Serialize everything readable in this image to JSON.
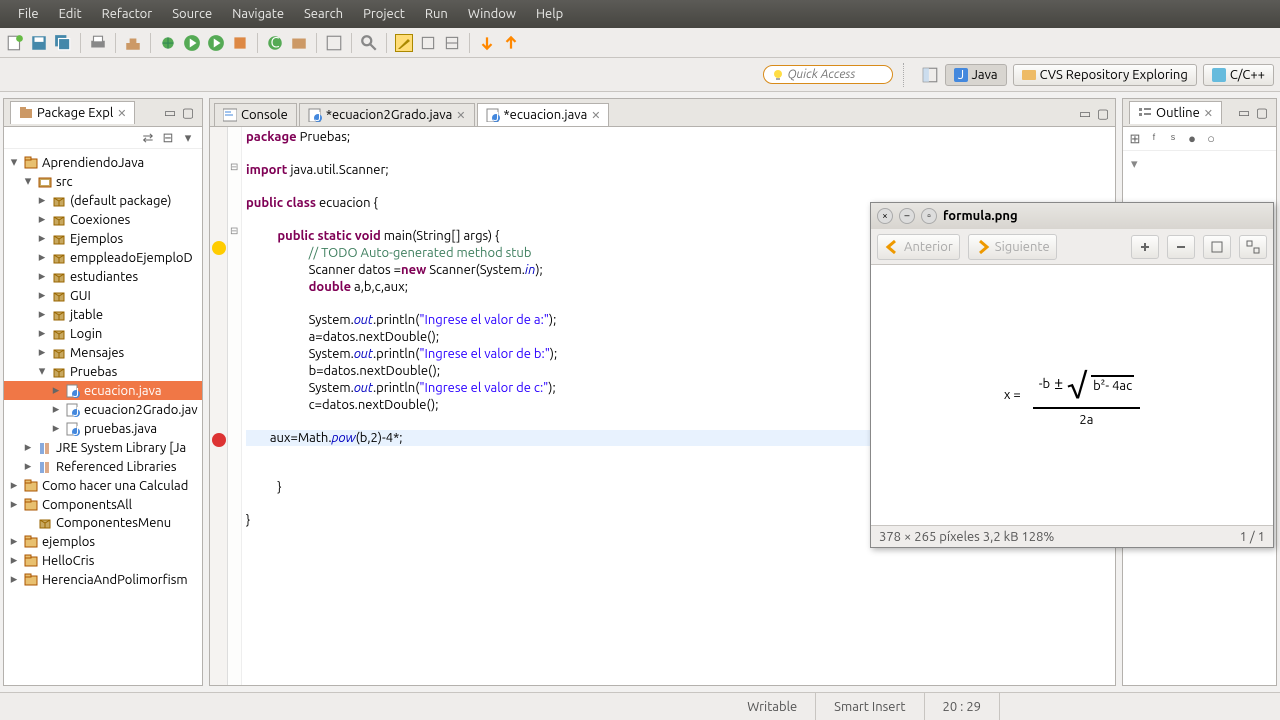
{
  "menu": [
    "File",
    "Edit",
    "Refactor",
    "Source",
    "Navigate",
    "Search",
    "Project",
    "Run",
    "Window",
    "Help"
  ],
  "quick_placeholder": "Quick Access",
  "perspectives": {
    "java": "Java",
    "cvs": "CVS Repository Exploring",
    "cpp": "C/C++"
  },
  "pkg_explorer": {
    "title": "Package Expl",
    "items": [
      {
        "ind": 0,
        "exp": "▾",
        "ico": "proj",
        "label": "AprendiendoJava"
      },
      {
        "ind": 1,
        "exp": "▾",
        "ico": "srcf",
        "label": "src"
      },
      {
        "ind": 2,
        "exp": "▸",
        "ico": "pkg",
        "label": "(default package)"
      },
      {
        "ind": 2,
        "exp": "▸",
        "ico": "pkg",
        "label": "Coexiones"
      },
      {
        "ind": 2,
        "exp": "▸",
        "ico": "pkg",
        "label": "Ejemplos"
      },
      {
        "ind": 2,
        "exp": "▸",
        "ico": "pkg",
        "label": "emppleadoEjemploD"
      },
      {
        "ind": 2,
        "exp": "▸",
        "ico": "pkg",
        "label": "estudiantes"
      },
      {
        "ind": 2,
        "exp": "▸",
        "ico": "pkg",
        "label": "GUI"
      },
      {
        "ind": 2,
        "exp": "▸",
        "ico": "pkg",
        "label": "jtable"
      },
      {
        "ind": 2,
        "exp": "▸",
        "ico": "pkg",
        "label": "Login"
      },
      {
        "ind": 2,
        "exp": "▸",
        "ico": "pkg",
        "label": "Mensajes"
      },
      {
        "ind": 2,
        "exp": "▾",
        "ico": "pkg",
        "label": "Pruebas"
      },
      {
        "ind": 3,
        "exp": "▸",
        "ico": "java",
        "label": "ecuacion.java",
        "sel": true
      },
      {
        "ind": 3,
        "exp": "▸",
        "ico": "java",
        "label": "ecuacion2Grado.jav"
      },
      {
        "ind": 3,
        "exp": "▸",
        "ico": "java",
        "label": "pruebas.java"
      },
      {
        "ind": 1,
        "exp": "▸",
        "ico": "lib",
        "label": "JRE System Library [Ja"
      },
      {
        "ind": 1,
        "exp": "▸",
        "ico": "lib",
        "label": "Referenced Libraries"
      },
      {
        "ind": 0,
        "exp": "▸",
        "ico": "proj",
        "label": "Como hacer una Calculad"
      },
      {
        "ind": 0,
        "exp": "▸",
        "ico": "proj",
        "label": "ComponentsAll"
      },
      {
        "ind": 1,
        "exp": "",
        "ico": "pkg",
        "label": "ComponentesMenu"
      },
      {
        "ind": 0,
        "exp": "▸",
        "ico": "proj",
        "label": "ejemplos"
      },
      {
        "ind": 0,
        "exp": "▸",
        "ico": "proj",
        "label": "HelloCris"
      },
      {
        "ind": 0,
        "exp": "▸",
        "ico": "proj",
        "label": "HerenciaAndPolimorfism"
      }
    ]
  },
  "editor_tabs": [
    {
      "icon": "console",
      "label": "Console",
      "dirty": false,
      "active": false
    },
    {
      "icon": "java",
      "label": "ecuacion2Grado.java",
      "dirty": true,
      "active": false
    },
    {
      "icon": "java",
      "label": "ecuacion.java",
      "dirty": true,
      "active": true
    }
  ],
  "code": {
    "l1a": "package",
    "l1b": " Pruebas;",
    "l2a": "import",
    "l2b": " java.util.Scanner;",
    "l3a": "public class",
    "l3b": " ecuacion {",
    "l4a": "public static void",
    "l4b": " main(String[] args) {",
    "l5": "// TODO Auto-generated method stub",
    "l6a": "Scanner datos =",
    "l6b": "new",
    "l6c": " Scanner(System.",
    "l6d": "in",
    "l6e": ");",
    "l7a": "double",
    "l7b": " a,b,c,aux;",
    "l8a": "System.",
    "l8b": "out",
    "l8c": ".println(",
    "l8d": "\"Ingrese el valor de a:\"",
    "l8e": ");",
    "l9": "a=datos.nextDouble();",
    "l10a": "System.",
    "l10b": "out",
    "l10c": ".println(",
    "l10d": "\"Ingrese el valor de b:\"",
    "l10e": ");",
    "l11": "b=datos.nextDouble();",
    "l12a": "System.",
    "l12b": "out",
    "l12c": ".println(",
    "l12d": "\"Ingrese el valor de c:\"",
    "l12e": ");",
    "l13": "c=datos.nextDouble();",
    "l14a": "aux=Math.",
    "l14b": "pow",
    "l14c": "(b,2)-4*;",
    "l15": "}",
    "l16": "}"
  },
  "outline": {
    "title": "Outline"
  },
  "status": {
    "writable": "Writable",
    "insert": "Smart Insert",
    "pos": "20 : 29"
  },
  "popup": {
    "title": "formula.png",
    "prev": "Anterior",
    "next": "Siguiente",
    "dims": "378 × 265 píxeles  3,2 kB   128%",
    "page": "1 / 1",
    "formula": {
      "x": "x  =",
      "neg_b": "-b",
      "pm": "±",
      "sqrt": "√",
      "disc": "b²- 4ac",
      "den": "2a"
    }
  }
}
